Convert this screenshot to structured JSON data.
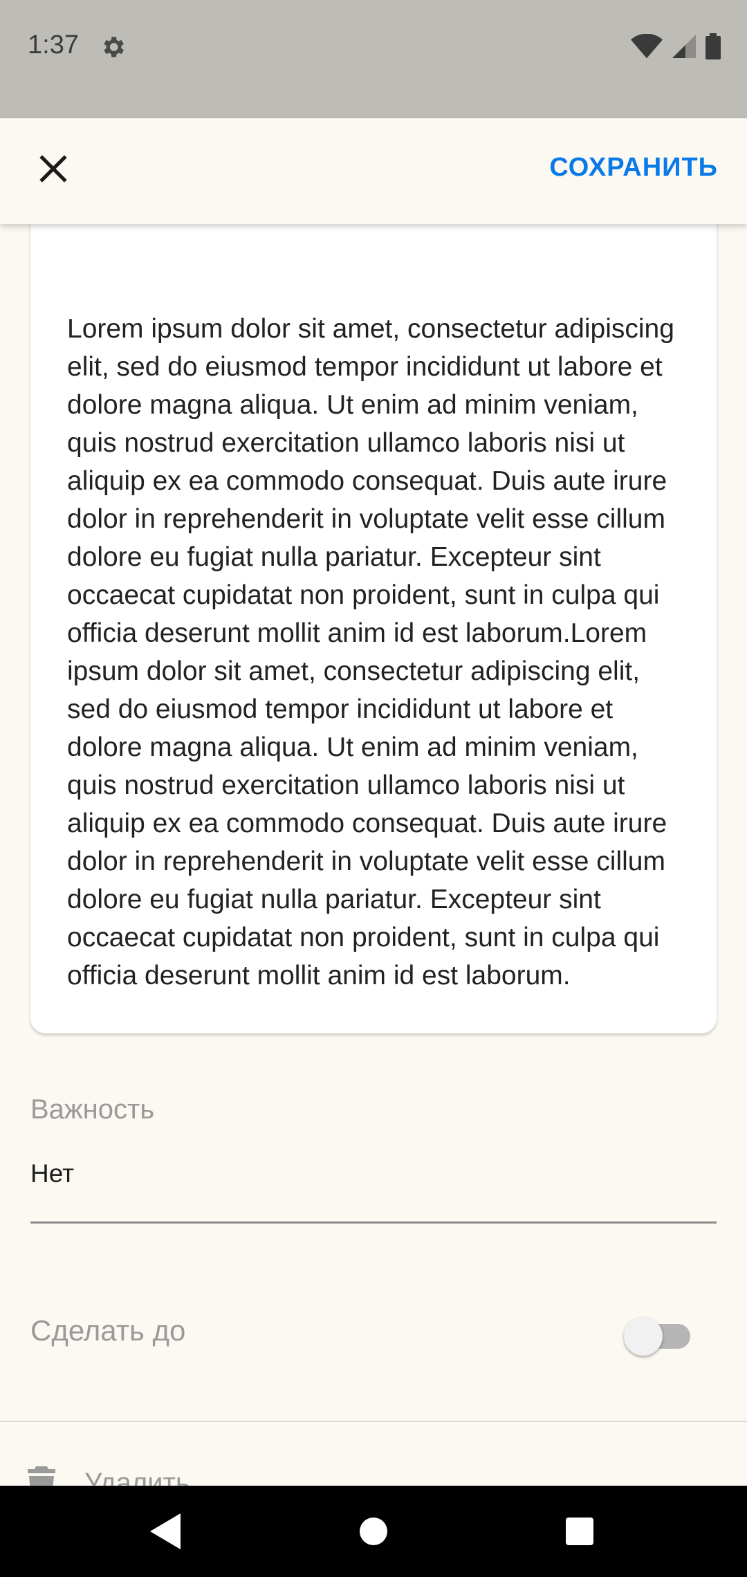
{
  "status_bar": {
    "time": "1:37",
    "icons": [
      "gear-icon",
      "wifi-icon",
      "signal-icon",
      "battery-icon"
    ]
  },
  "app_bar": {
    "close_icon": "close-icon",
    "save_label": "СОХРАНИТЬ",
    "accent_color": "#0a7ae8"
  },
  "note": {
    "text": "Lorem ipsum dolor sit amet, consectetur adipiscing elit, sed do eiusmod tempor incididunt ut labore et dolore magna aliqua. Ut enim ad minim veniam, quis nostrud exercitation ullamco laboris nisi ut aliquip ex ea commodo consequat. Duis aute irure dolor in reprehenderit in voluptate velit esse cillum dolore eu fugiat nulla pariatur. Excepteur sint occaecat cupidatat non proident, sunt in culpa qui officia deserunt mollit anim id est laborum.Lorem ipsum dolor sit amet, consectetur adipiscing elit, sed do eiusmod tempor incididunt ut labore et dolore magna aliqua. Ut enim ad minim veniam, quis nostrud exercitation ullamco laboris nisi ut aliquip ex ea commodo consequat. Duis aute irure dolor in reprehenderit in voluptate velit esse cillum dolore eu fugiat nulla pariatur. Excepteur sint occaecat cupidatat non proident, sunt in culpa qui officia deserunt mollit anim id est laborum."
  },
  "importance": {
    "label": "Важность",
    "value": "Нет"
  },
  "deadline": {
    "label": "Сделать до",
    "enabled": false
  },
  "delete": {
    "label": "Удалить",
    "icon": "trash-icon"
  },
  "nav_bar": {
    "icons": [
      "back-icon",
      "home-icon",
      "recents-icon"
    ]
  }
}
